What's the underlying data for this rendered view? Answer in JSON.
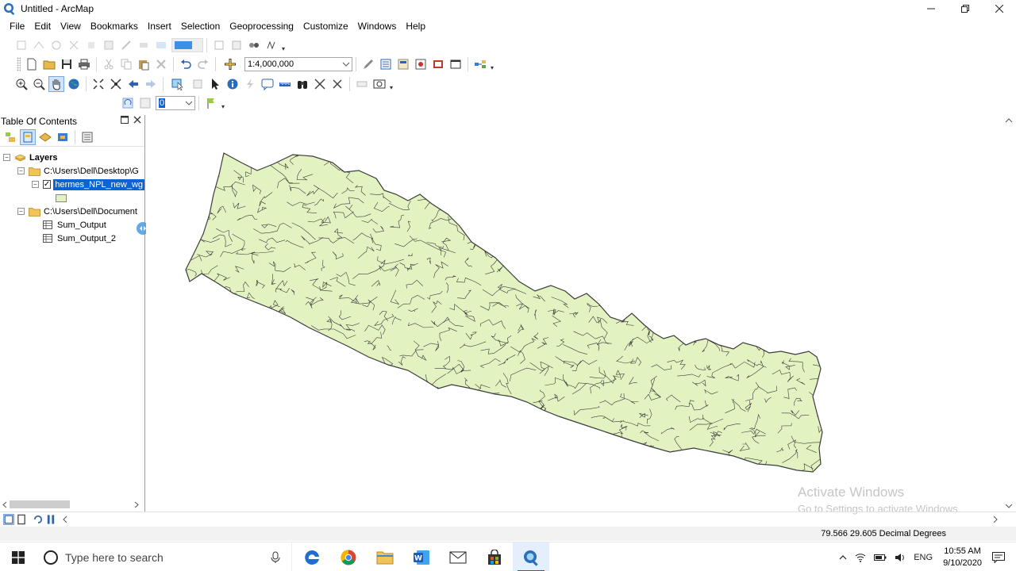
{
  "window": {
    "title": "Untitled - ArcMap",
    "controls": [
      "minimize",
      "maximize",
      "close"
    ]
  },
  "menubar": {
    "items": [
      "File",
      "Edit",
      "View",
      "Bookmarks",
      "Insert",
      "Selection",
      "Geoprocessing",
      "Customize",
      "Windows",
      "Help"
    ]
  },
  "standard_toolbar": {
    "scale": "1:4,000,000"
  },
  "time_toolbar": {
    "value": "0"
  },
  "toc": {
    "title": "Table Of Contents",
    "root": "Layers",
    "folder1": "C:\\Users\\Dell\\Desktop\\G",
    "layer1": "hermes_NPL_new_wg",
    "layer1_checked": true,
    "folder2": "C:\\Users\\Dell\\Document",
    "tables": [
      "Sum_Output",
      "Sum_Output_2"
    ]
  },
  "map": {
    "fill_color": "#e3f2c1",
    "stroke_color": "#3c3c3c"
  },
  "watermark": {
    "line1": "Activate Windows",
    "line2": "Go to Settings to activate Windows."
  },
  "status": {
    "coordinates": "79.566  29.605 Decimal Degrees"
  },
  "taskbar": {
    "search_placeholder": "Type here to search",
    "lang": "ENG",
    "time": "10:55 AM",
    "date": "9/10/2020"
  },
  "colors": {
    "selection": "#0a64d6",
    "accent": "#0f6cbd"
  }
}
